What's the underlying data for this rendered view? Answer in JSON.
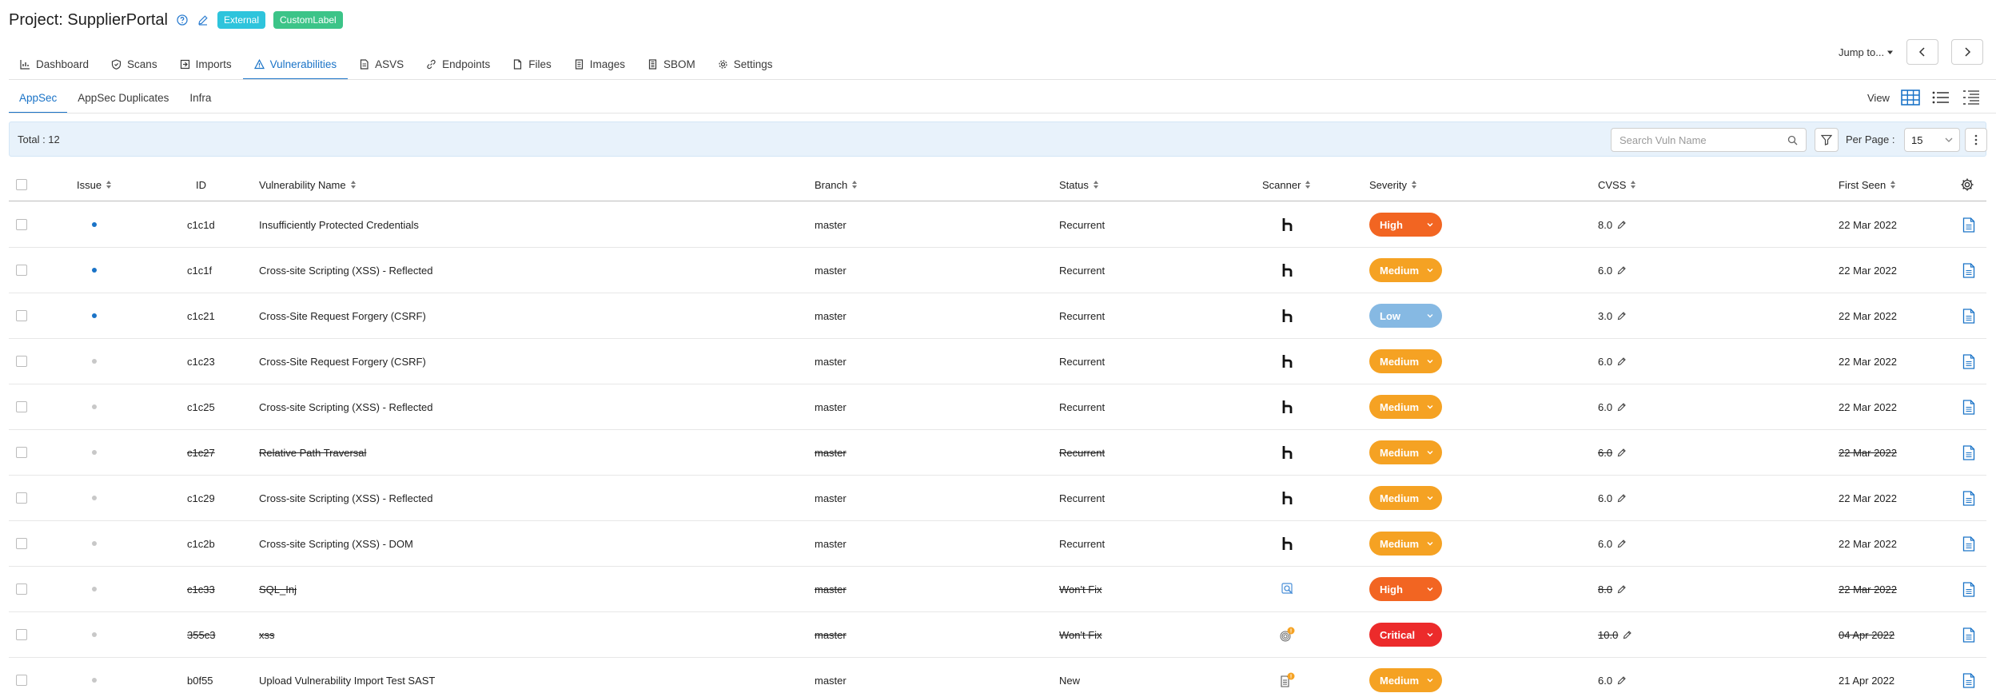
{
  "header": {
    "project_title": "Project: SupplierPortal",
    "badges": [
      {
        "label": "External",
        "color": "#2ec4dc"
      },
      {
        "label": "CustomLabel",
        "color": "#3cc488"
      }
    ]
  },
  "tabs": [
    {
      "label": "Dashboard",
      "icon": "bar-chart-icon",
      "active": false
    },
    {
      "label": "Scans",
      "icon": "shield-icon",
      "active": false
    },
    {
      "label": "Imports",
      "icon": "import-icon",
      "active": false
    },
    {
      "label": "Vulnerabilities",
      "icon": "warning-triangle-icon",
      "active": true
    },
    {
      "label": "ASVS",
      "icon": "document-icon",
      "active": false
    },
    {
      "label": "Endpoints",
      "icon": "link-icon",
      "active": false
    },
    {
      "label": "Files",
      "icon": "file-icon",
      "active": false
    },
    {
      "label": "Images",
      "icon": "image-file-icon",
      "active": false
    },
    {
      "label": "SBOM",
      "icon": "list-file-icon",
      "active": false
    },
    {
      "label": "Settings",
      "icon": "gear-icon",
      "active": false
    }
  ],
  "jump_to": "Jump to...",
  "subtabs": [
    {
      "label": "AppSec",
      "active": true
    },
    {
      "label": "AppSec Duplicates",
      "active": false
    },
    {
      "label": "Infra",
      "active": false
    }
  ],
  "view_label": "View",
  "toolbar": {
    "total": "Total : 12",
    "search_placeholder": "Search Vuln Name",
    "per_page_label": "Per Page :",
    "per_page_value": "15"
  },
  "columns": {
    "issue": "Issue",
    "id": "ID",
    "name": "Vulnerability Name",
    "branch": "Branch",
    "status": "Status",
    "scanner": "Scanner",
    "severity": "Severity",
    "cvss": "CVSS",
    "first_seen": "First Seen"
  },
  "colors": {
    "accent": "#1a73c7",
    "high": "#f26522",
    "medium": "#f5a223",
    "low": "#86b9e3",
    "critical": "#ec2b2b",
    "dot_active": "#1a73c7",
    "dot_inactive": "#c8c8c8"
  },
  "rows": [
    {
      "issue_active": true,
      "id": "c1c1d",
      "name": "Insufficiently Protected Credentials",
      "branch": "master",
      "status": "Recurrent",
      "scanner": "h-scanner-icon",
      "severity": "High",
      "cvss": "8.0",
      "first_seen": "22 Mar 2022",
      "struck": false
    },
    {
      "issue_active": true,
      "id": "c1c1f",
      "name": "Cross-site Scripting (XSS) - Reflected",
      "branch": "master",
      "status": "Recurrent",
      "scanner": "h-scanner-icon",
      "severity": "Medium",
      "cvss": "6.0",
      "first_seen": "22 Mar 2022",
      "struck": false
    },
    {
      "issue_active": true,
      "id": "c1c21",
      "name": "Cross-Site Request Forgery (CSRF)",
      "branch": "master",
      "status": "Recurrent",
      "scanner": "h-scanner-icon",
      "severity": "Low",
      "cvss": "3.0",
      "first_seen": "22 Mar 2022",
      "struck": false
    },
    {
      "issue_active": false,
      "id": "c1c23",
      "name": "Cross-Site Request Forgery (CSRF)",
      "branch": "master",
      "status": "Recurrent",
      "scanner": "h-scanner-icon",
      "severity": "Medium",
      "cvss": "6.0",
      "first_seen": "22 Mar 2022",
      "struck": false
    },
    {
      "issue_active": false,
      "id": "c1c25",
      "name": "Cross-site Scripting (XSS) - Reflected",
      "branch": "master",
      "status": "Recurrent",
      "scanner": "h-scanner-icon",
      "severity": "Medium",
      "cvss": "6.0",
      "first_seen": "22 Mar 2022",
      "struck": false
    },
    {
      "issue_active": false,
      "id": "c1c27",
      "name": "Relative Path Traversal",
      "branch": "master",
      "status": "Recurrent",
      "scanner": "h-scanner-icon",
      "severity": "Medium",
      "cvss": "6.0",
      "first_seen": "22 Mar 2022",
      "struck": true
    },
    {
      "issue_active": false,
      "id": "c1c29",
      "name": "Cross-site Scripting (XSS) - Reflected",
      "branch": "master",
      "status": "Recurrent",
      "scanner": "h-scanner-icon",
      "severity": "Medium",
      "cvss": "6.0",
      "first_seen": "22 Mar 2022",
      "struck": false
    },
    {
      "issue_active": false,
      "id": "c1c2b",
      "name": "Cross-site Scripting (XSS) - DOM",
      "branch": "master",
      "status": "Recurrent",
      "scanner": "h-scanner-icon",
      "severity": "Medium",
      "cvss": "6.0",
      "first_seen": "22 Mar 2022",
      "struck": false
    },
    {
      "issue_active": false,
      "id": "c1c33",
      "name": "SQL_Inj",
      "branch": "master",
      "status": "Won't Fix",
      "scanner": "magnifier-scanner-icon",
      "severity": "High",
      "cvss": "8.0",
      "first_seen": "22 Mar 2022",
      "struck": true
    },
    {
      "issue_active": false,
      "id": "355c3",
      "name": "xss",
      "branch": "master",
      "status": "Won't Fix",
      "scanner": "fingerprint-alert-scanner-icon",
      "severity": "Critical",
      "cvss": "10.0",
      "first_seen": "04 Apr 2022",
      "struck": true
    },
    {
      "issue_active": false,
      "id": "b0f55",
      "name": "Upload Vulnerability Import Test SAST",
      "branch": "master",
      "status": "New",
      "scanner": "document-alert-scanner-icon",
      "severity": "Medium",
      "cvss": "6.0",
      "first_seen": "21 Apr 2022",
      "struck": false
    }
  ]
}
